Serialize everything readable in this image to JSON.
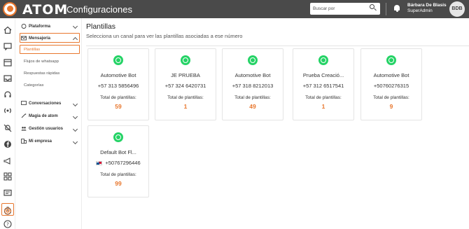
{
  "header": {
    "brand": "ATOM",
    "section": "Configuraciones",
    "search_placeholder": "Buscar por",
    "user_name": "Bárbara De Blasis",
    "user_role": "SuperAdmin",
    "avatar_initials": "BDB"
  },
  "rail": {
    "icons": [
      "home-icon",
      "chat-icon",
      "calendar-icon",
      "inbox-icon",
      "headset-icon",
      "broadcast-icon",
      "mute-icon",
      "facebook-icon",
      "megaphone-icon",
      "grid-icon",
      "message-icon",
      "timer-icon",
      "settings-icon",
      "help-icon"
    ],
    "active": "settings-icon"
  },
  "menu": {
    "plataforma": "Plataforma",
    "mensajeria": "Mensajería",
    "plantillas": "Plantillas",
    "flujos": "Flujos de whatsapp",
    "respuestas": "Respuestas rápidas",
    "categorias": "Categorías",
    "conversaciones": "Conversaciones",
    "magia": "Magia de atom",
    "gestion": "Gestión usuarios",
    "empresa": "Mi empresa"
  },
  "main": {
    "title": "Plantillas",
    "subtitle": "Selecciona un canal para ver las plantillas asociadas a ese número",
    "total_label": "Total de plantillas:",
    "cards": [
      {
        "name": "Automotive Bot",
        "phone": "+57 313 5856496",
        "count": "59"
      },
      {
        "name": "JE PRUEBA",
        "phone": "+57 324 6420731",
        "count": "1"
      },
      {
        "name": "Automotive Bot",
        "phone": "+57 318 8212013",
        "count": "49"
      },
      {
        "name": "Prueba Creació...",
        "phone": "+57 312 6517541",
        "count": "1"
      },
      {
        "name": "Automotive Bot",
        "phone": "+50760276315",
        "count": "9"
      },
      {
        "name": "Default Bot Fl...",
        "phone": "+50767296446",
        "count": "99"
      }
    ]
  },
  "colors": {
    "accent": "#e8772e",
    "header": "#4a4a4a",
    "whatsapp": "#25d366"
  }
}
